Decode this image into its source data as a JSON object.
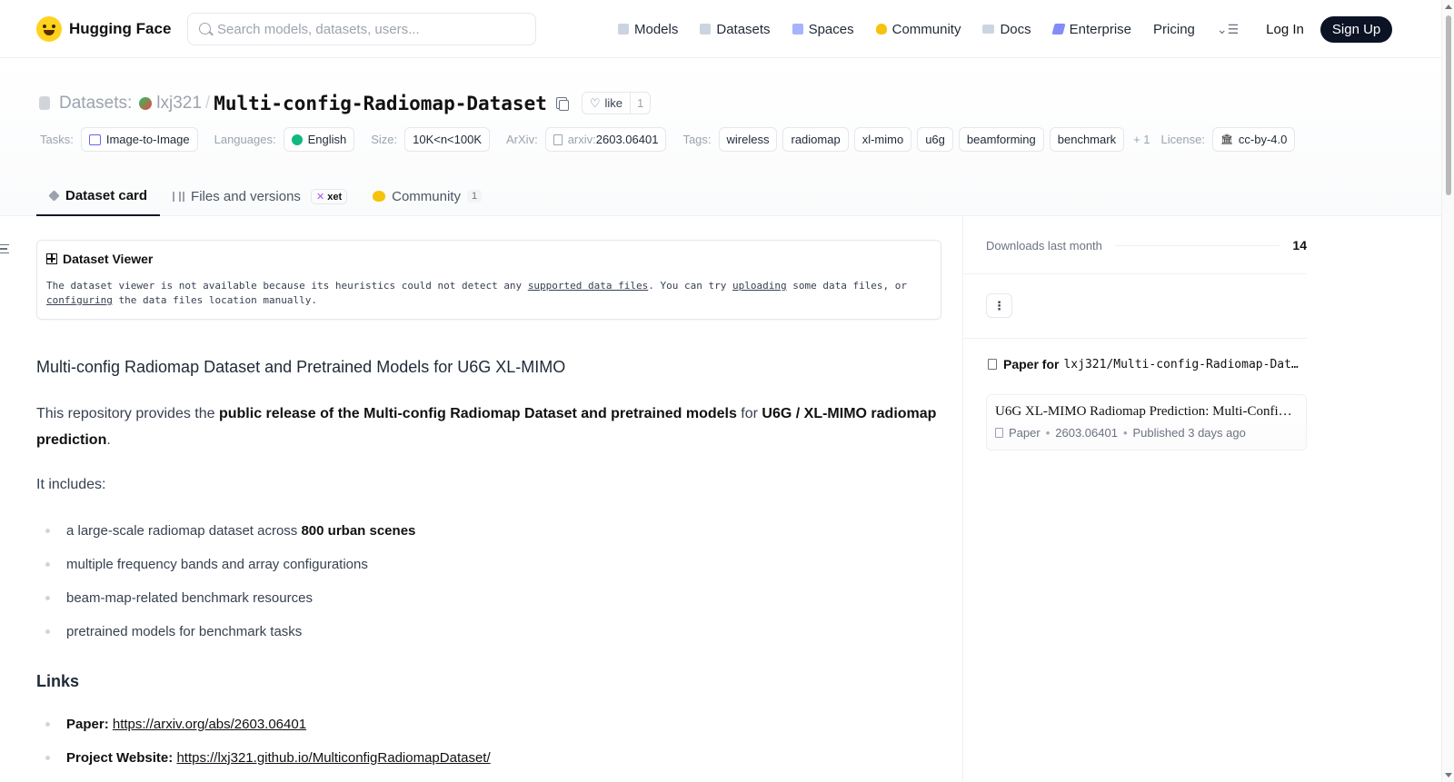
{
  "nav": {
    "brand": "Hugging Face",
    "search_placeholder": "Search models, datasets, users...",
    "links": [
      "Models",
      "Datasets",
      "Spaces",
      "Community",
      "Docs",
      "Enterprise",
      "Pricing"
    ],
    "login": "Log In",
    "signup": "Sign Up"
  },
  "repo": {
    "type_label": "Datasets:",
    "owner": "lxj321",
    "name": "Multi-config-Radiomap-Dataset",
    "like_label": "like",
    "like_count": "1"
  },
  "meta": {
    "tasks_label": "Tasks:",
    "task": "Image-to-Image",
    "languages_label": "Languages:",
    "language": "English",
    "size_label": "Size:",
    "size": "10K<n<100K",
    "arxiv_label": "ArXiv:",
    "arxiv_prefix": "arxiv:",
    "arxiv_id": "2603.06401",
    "tags_label": "Tags:",
    "tags": [
      "wireless",
      "radiomap",
      "xl-mimo",
      "u6g",
      "beamforming",
      "benchmark"
    ],
    "tags_more": "+ 1",
    "license_label": "License:",
    "license": "cc-by-4.0"
  },
  "tabs": {
    "card": "Dataset card",
    "files": "Files and versions",
    "xet": "xet",
    "community": "Community",
    "community_count": "1"
  },
  "viewer": {
    "title": "Dataset Viewer",
    "msg_1": "The dataset viewer is not available because its heuristics could not detect any ",
    "link_1": "supported data files",
    "msg_2": ". You can try ",
    "link_2": "uploading",
    "msg_3": " some data files, or ",
    "link_3": "configuring",
    "msg_4": " the data files location manually."
  },
  "card": {
    "heading": "Multi-config Radiomap Dataset and Pretrained Models for U6G XL-MIMO",
    "intro_1": "This repository provides the ",
    "intro_bold_1": "public release of the Multi-config Radiomap Dataset and pretrained models",
    "intro_2": " for ",
    "intro_bold_2": "U6G / XL-MIMO radiomap prediction",
    "intro_3": ".",
    "includes": "It includes:",
    "bullet_1_pre": "a large-scale radiomap dataset across ",
    "bullet_1_bold": "800 urban scenes",
    "bullet_2": "multiple frequency bands and array configurations",
    "bullet_3": "beam-map-related benchmark resources",
    "bullet_4": "pretrained models for benchmark tasks",
    "links_heading": "Links",
    "paper_label": "Paper:",
    "paper_url": "https://arxiv.org/abs/2603.06401",
    "website_label": "Project Website:",
    "website_url": "https://lxj321.github.io/MulticonfigRadiomapDataset/"
  },
  "sidebar": {
    "downloads_label": "Downloads last month",
    "downloads_value": "14",
    "kebab": "⋮",
    "paper_for_label": "Paper for",
    "paper_for_repo": "lxj321/Multi-config-Radiomap-Dat…",
    "paper_title": "U6G XL-MIMO Radiomap Prediction: Multi-Confi…",
    "paper_kind": "Paper",
    "paper_id": "2603.06401",
    "paper_published": "Published 3 days ago"
  }
}
